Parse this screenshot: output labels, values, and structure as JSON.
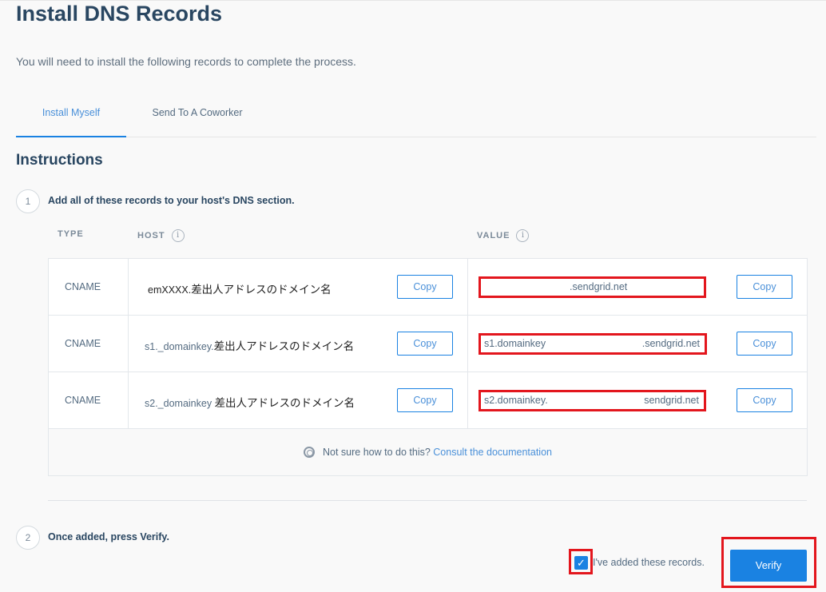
{
  "page": {
    "title": "Install DNS Records",
    "subtitle": "You will need to install the following records to complete the process."
  },
  "tabs": [
    {
      "label": "Install Myself",
      "active": true
    },
    {
      "label": "Send To A Coworker",
      "active": false
    }
  ],
  "instructions": {
    "title": "Instructions",
    "step1": {
      "number": "1",
      "text": "Add all of these records to your host's DNS section."
    },
    "step2": {
      "number": "2",
      "text": "Once added, press Verify."
    }
  },
  "table": {
    "headers": {
      "type": "TYPE",
      "host": "HOST",
      "value": "VALUE"
    },
    "info_icon": "info-icon",
    "copy_label": "Copy",
    "rows": [
      {
        "type": "CNAME",
        "host_prefix": "emXXXX.",
        "host_suffix": "差出人アドレスのドメイン名",
        "value_left": "",
        "value_right": ".sendgrid.net"
      },
      {
        "type": "CNAME",
        "host_prefix": "s1._domainkey.",
        "host_suffix": "差出人アドレスのドメイン名",
        "value_left": "s1.domainkey",
        "value_right": ".sendgrid.net"
      },
      {
        "type": "CNAME",
        "host_prefix": "s2._domainkey",
        "host_suffix": "差出人アドレスのドメイン名",
        "value_left": "s2.domainkey.",
        "value_right": "sendgrid.net"
      }
    ],
    "help": {
      "icon": "lifebuoy-icon",
      "text": "Not sure how to do this?",
      "link": "Consult the documentation"
    }
  },
  "verify": {
    "checkbox_checked": true,
    "checkbox_label": "I've added these records.",
    "button_label": "Verify"
  },
  "colors": {
    "accent": "#1a82e2",
    "title": "#294661",
    "highlight": "#e3161d"
  }
}
